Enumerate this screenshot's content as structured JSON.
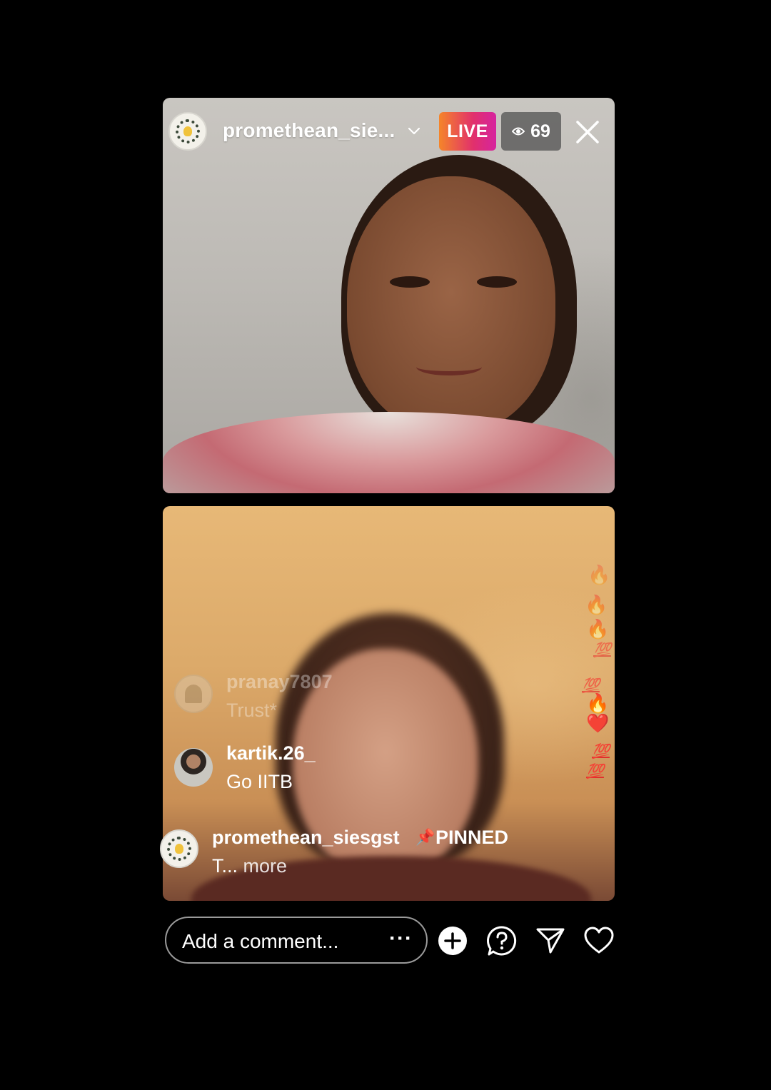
{
  "header": {
    "username": "promethean_sie...",
    "live_label": "LIVE",
    "viewer_count": "69"
  },
  "comments": [
    {
      "user": "pranay7807",
      "text": "Trust*"
    },
    {
      "user": "kartik.26_",
      "text": "Go IITB"
    }
  ],
  "pinned": {
    "user": "promethean_siesgst",
    "pin_icon": "📌",
    "label": "PINNED",
    "text": "T...",
    "more": "more"
  },
  "reactions": [
    "🔥",
    "🔥",
    "🔥",
    "💯",
    "💯",
    "🔥",
    "❤️",
    "💯",
    "💯"
  ],
  "bottom_bar": {
    "comment_placeholder": "Add a comment...",
    "more_options": "···"
  },
  "colors": {
    "background": "#000000",
    "live_gradient_start": "#f58529",
    "live_gradient_end": "#d6249f"
  }
}
